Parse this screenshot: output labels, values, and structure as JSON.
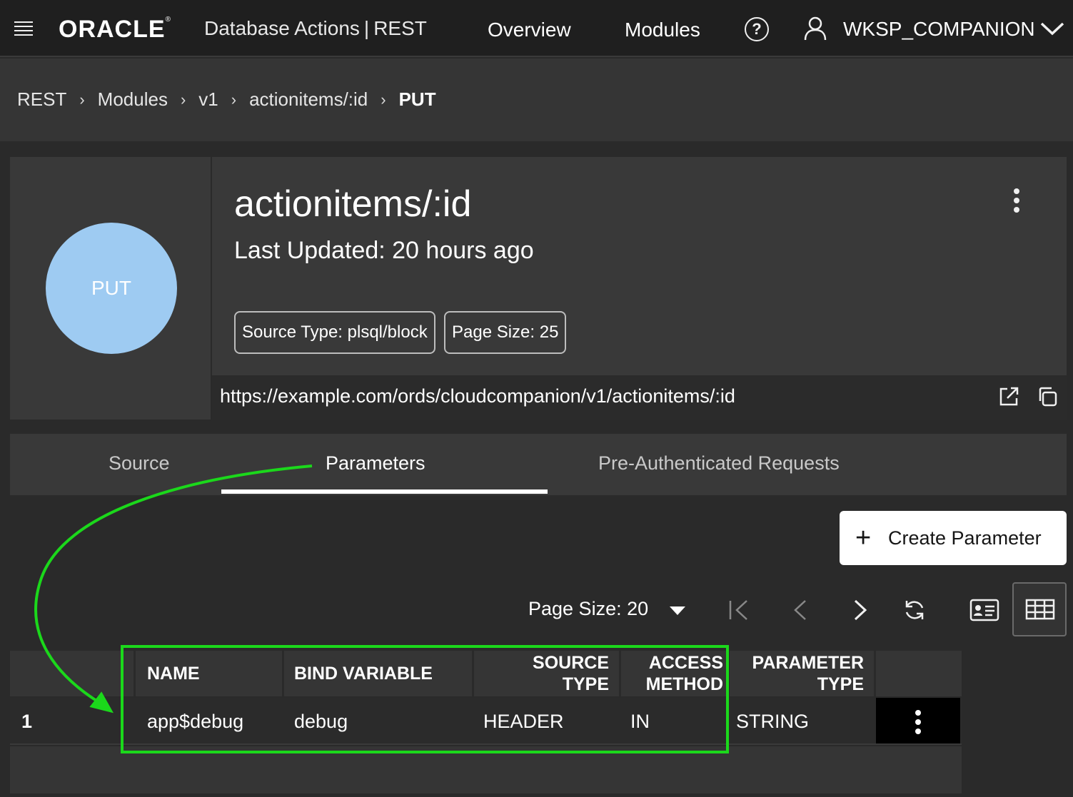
{
  "header": {
    "brand": "ORACLE",
    "trademark": "®",
    "product": "Database Actions",
    "separator": "|",
    "section": "REST",
    "nav": [
      {
        "label": "Overview"
      },
      {
        "label": "Modules"
      }
    ],
    "help_glyph": "?",
    "user": "WKSP_COMPANION",
    "icons": {
      "menu": "hamburger-icon",
      "help": "help-icon",
      "user": "user-icon",
      "dropdown": "chevron-down-icon"
    }
  },
  "breadcrumb": {
    "items": [
      "REST",
      "Modules",
      "v1",
      "actionitems/:id"
    ],
    "current": "PUT",
    "separator": "›"
  },
  "handler": {
    "method": "PUT",
    "method_color": "#9ecbf2",
    "title": "actionitems/:id",
    "updated": "Last Updated: 20 hours ago",
    "chips": [
      "Source Type: plsql/block",
      "Page Size: 25"
    ],
    "url": "https://example.com/ords/cloudcompanion/v1/actionitems/:id"
  },
  "tabs": [
    {
      "label": "Source",
      "active": false
    },
    {
      "label": "Parameters",
      "active": true
    },
    {
      "label": "Pre-Authenticated Requests",
      "active": false
    }
  ],
  "actions": {
    "create_label": "Create Parameter",
    "plus": "+"
  },
  "pager": {
    "page_size_label": "Page Size: 20"
  },
  "table": {
    "columns": [
      {
        "line1": "NAME",
        "line2": ""
      },
      {
        "line1": "BIND VARIABLE",
        "line2": ""
      },
      {
        "line1": "SOURCE",
        "line2": "TYPE"
      },
      {
        "line1": "ACCESS",
        "line2": "METHOD"
      },
      {
        "line1": "PARAMETER",
        "line2": "TYPE"
      }
    ],
    "rows": [
      {
        "index": "1",
        "name": "app$debug",
        "bind": "debug",
        "source_type": "HEADER",
        "access_method": "IN",
        "param_type": "STRING"
      }
    ]
  },
  "colors": {
    "highlight": "#1bd81b",
    "background": "#2a2a2a",
    "card": "#393939"
  }
}
